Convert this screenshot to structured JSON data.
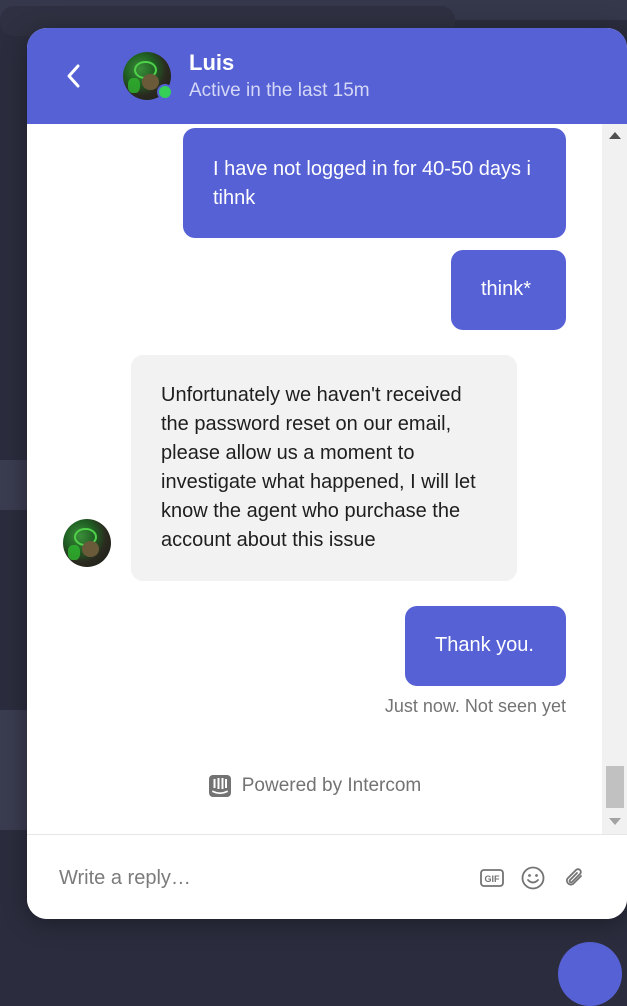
{
  "header": {
    "agent_name": "Luis",
    "agent_status": "Active in the last 15m"
  },
  "messages": [
    {
      "from": "user",
      "text": "I have not logged in for 40-50 days i tihnk"
    },
    {
      "from": "user",
      "text": "think*"
    },
    {
      "from": "agent",
      "text": "Unfortunately we haven't received the password reset on our email, please allow us a moment to investigate what happened, I will let know the agent who purchase the account about this issue"
    },
    {
      "from": "user",
      "text": "Thank you."
    }
  ],
  "receipt": "Just now. Not seen yet",
  "powered_by": "Powered by Intercom",
  "composer": {
    "placeholder": "Write a reply…",
    "gif_label": "GIF"
  },
  "icons": {
    "back": "chevron-left-icon",
    "gif": "gif-icon",
    "emoji": "emoji-icon",
    "attach": "paperclip-icon",
    "intercom": "intercom-logo-icon"
  },
  "colors": {
    "brand": "#5661d6",
    "agent_bubble": "#f2f2f2",
    "online": "#34d058"
  }
}
